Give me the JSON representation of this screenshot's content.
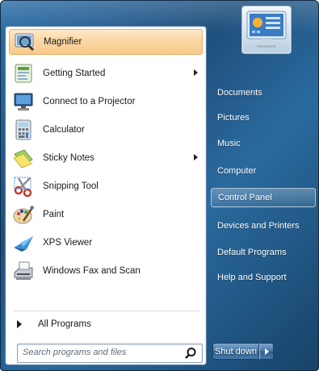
{
  "programs": [
    {
      "label": "Magnifier",
      "icon": "magnifier-icon",
      "highlighted": true,
      "submenu": false
    },
    {
      "label": "Getting Started",
      "icon": "getting-started-icon",
      "highlighted": false,
      "submenu": true
    },
    {
      "label": "Connect to a Projector",
      "icon": "projector-icon",
      "highlighted": false,
      "submenu": false
    },
    {
      "label": "Calculator",
      "icon": "calculator-icon",
      "highlighted": false,
      "submenu": false
    },
    {
      "label": "Sticky Notes",
      "icon": "sticky-notes-icon",
      "highlighted": false,
      "submenu": true
    },
    {
      "label": "Snipping Tool",
      "icon": "snipping-tool-icon",
      "highlighted": false,
      "submenu": false
    },
    {
      "label": "Paint",
      "icon": "paint-icon",
      "highlighted": false,
      "submenu": false
    },
    {
      "label": "XPS Viewer",
      "icon": "xps-viewer-icon",
      "highlighted": false,
      "submenu": false
    },
    {
      "label": "Windows Fax and Scan",
      "icon": "fax-scan-icon",
      "highlighted": false,
      "submenu": false
    }
  ],
  "all_programs": {
    "label": "All Programs"
  },
  "search": {
    "placeholder": "Search programs and files"
  },
  "right_items": [
    {
      "label": "Documents",
      "highlighted": false
    },
    {
      "label": "Pictures",
      "highlighted": false
    },
    {
      "label": "Music",
      "highlighted": false
    },
    {
      "label": "Computer",
      "highlighted": false
    },
    {
      "label": "Control Panel",
      "highlighted": true
    },
    {
      "label": "Devices and Printers",
      "highlighted": false
    },
    {
      "label": "Default Programs",
      "highlighted": false
    },
    {
      "label": "Help and Support",
      "highlighted": false
    }
  ],
  "shutdown": {
    "label": "Shut down"
  },
  "colors": {
    "frame": "#1f4f7c",
    "highlight": "#fbd7a5",
    "accent": "#4a77a5"
  }
}
